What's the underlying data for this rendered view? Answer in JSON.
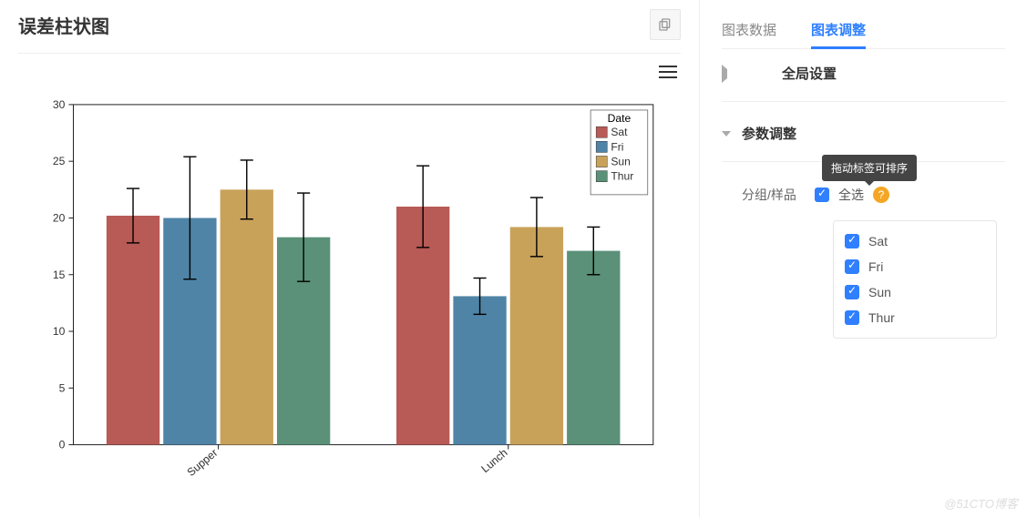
{
  "page_title": "误差柱状图",
  "tabs": {
    "data": "图表数据",
    "adjust": "图表调整"
  },
  "sections": {
    "global": "全局设置",
    "params": "参数调整"
  },
  "param": {
    "group_label": "分组/样品",
    "select_all": "全选",
    "tooltip": "拖动标签可排序",
    "items": [
      "Sat",
      "Fri",
      "Sun",
      "Thur"
    ]
  },
  "watermark": "@51CTO博客",
  "chart_data": {
    "type": "bar",
    "legend_title": "Date",
    "categories": [
      "Supper",
      "Lunch"
    ],
    "series_order": [
      "Sat",
      "Fri",
      "Sun",
      "Thur"
    ],
    "colors": {
      "Sat": "#b85a55",
      "Fri": "#4f84a6",
      "Sun": "#c9a25a",
      "Thur": "#5a9178"
    },
    "series": [
      {
        "name": "Sat",
        "values": [
          20.2,
          21.0
        ],
        "errors": [
          2.4,
          3.6
        ]
      },
      {
        "name": "Fri",
        "values": [
          20.0,
          13.1
        ],
        "errors": [
          5.4,
          1.6
        ]
      },
      {
        "name": "Sun",
        "values": [
          22.5,
          19.2
        ],
        "errors": [
          2.6,
          2.6
        ]
      },
      {
        "name": "Thur",
        "values": [
          18.3,
          17.1
        ],
        "errors": [
          3.9,
          2.1
        ]
      }
    ],
    "ylim": [
      0,
      30
    ],
    "yticks": [
      0,
      5,
      10,
      15,
      20,
      25,
      30
    ],
    "xlabel": "",
    "ylabel": "",
    "title": ""
  }
}
